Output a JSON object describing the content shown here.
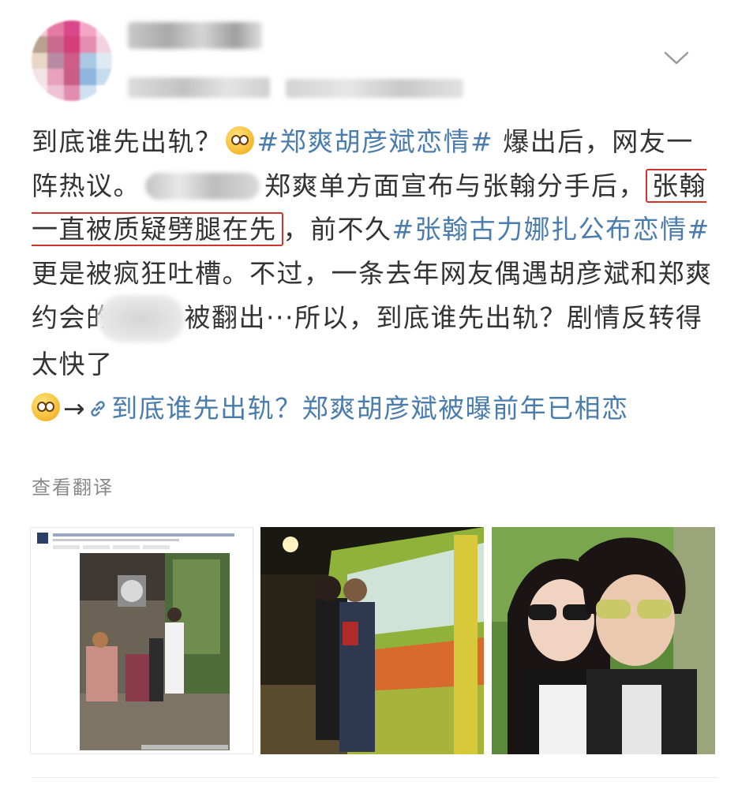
{
  "post": {
    "t1": "到底谁先出轨？",
    "topic1": "#郑爽胡彦斌恋情#",
    "t2": " 爆出后，网友一阵热议。",
    "t3": "郑爽单方面宣布与张翰分手后，",
    "highlight": "张翰一直被质疑劈腿在先",
    "t4": "，前不久",
    "topic2": "#张翰古力娜扎公布恋情#",
    "t5": " 更是被疯狂吐槽。不过，一条去年网友偶遇胡彦斌和郑爽约会的",
    "t6": "被翻出···所以，到底谁先出轨？剧情反转得太快了",
    "arrow": "→",
    "link": "到底谁先出轨？郑爽胡彦斌被曝前年已相恋",
    "translate": "查看翻译"
  },
  "icons": {
    "emoji1": "squinting-face-emoji",
    "emoji2": "dizzy-face-emoji",
    "link": "chain-link-icon",
    "chevron": "chevron-down-icon"
  },
  "colors": {
    "link": "#4a7cad",
    "highlight_border": "#d0342c",
    "text": "#333333"
  }
}
